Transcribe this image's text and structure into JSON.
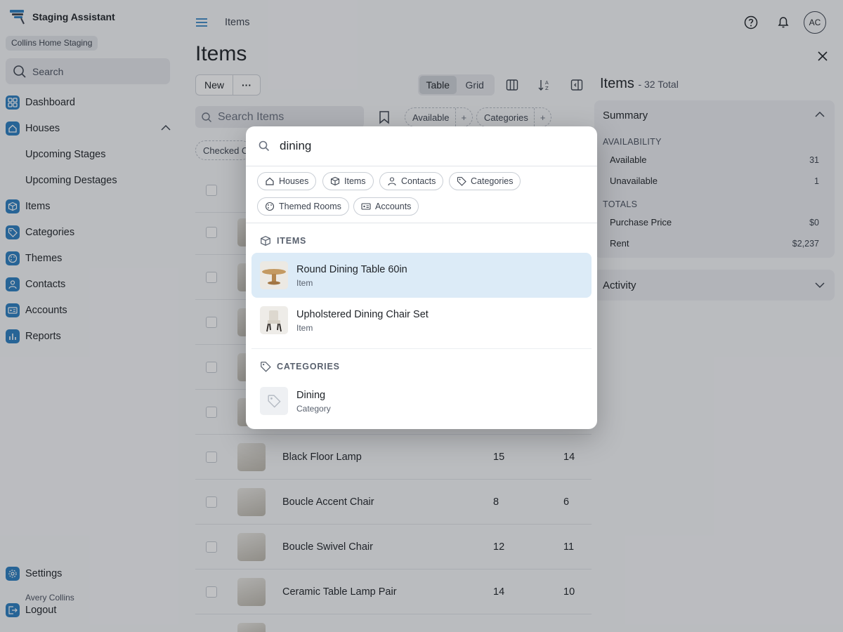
{
  "app": {
    "title": "Staging Assistant",
    "workspace": "Collins Home Staging",
    "search_label": "Search"
  },
  "sidebar": {
    "items": [
      {
        "label": "Dashboard",
        "icon": "grid-icon"
      },
      {
        "label": "Houses",
        "icon": "home-icon",
        "expanded": true
      },
      {
        "label": "Upcoming Stages",
        "sub": true
      },
      {
        "label": "Upcoming Destages",
        "sub": true
      },
      {
        "label": "Items",
        "icon": "box-icon"
      },
      {
        "label": "Categories",
        "icon": "tag-icon"
      },
      {
        "label": "Themes",
        "icon": "palette-icon"
      },
      {
        "label": "Contacts",
        "icon": "person-icon"
      },
      {
        "label": "Accounts",
        "icon": "id-card-icon"
      },
      {
        "label": "Reports",
        "icon": "bar-chart-icon"
      }
    ],
    "settings_label": "Settings",
    "user_name": "Avery Collins",
    "logout_label": "Logout"
  },
  "topbar": {
    "breadcrumb": "Items",
    "avatar_initials": "AC"
  },
  "main": {
    "title": "Items",
    "new_label": "New",
    "more_label": "···",
    "view_toggle": {
      "table": "Table",
      "grid": "Grid",
      "active": "Table"
    },
    "search_placeholder": "Search Items",
    "filters": {
      "available": "Available",
      "categories": "Categories",
      "checked": "Checked C"
    },
    "rows": [
      {
        "name": "Black Floor Lamp",
        "q1": "15",
        "q2": "14"
      },
      {
        "name": "Boucle Accent Chair",
        "q1": "8",
        "q2": "6"
      },
      {
        "name": "Boucle Swivel Chair",
        "q1": "12",
        "q2": "11"
      },
      {
        "name": "Ceramic Table Lamp Pair",
        "q1": "14",
        "q2": "10"
      }
    ]
  },
  "panel": {
    "title": "Items",
    "total": "- 32 Total",
    "summary_label": "Summary",
    "availability_label": "AVAILABILITY",
    "available_label": "Available",
    "available_value": "31",
    "unavailable_label": "Unavailable",
    "unavailable_value": "1",
    "totals_label": "TOTALS",
    "purchase_label": "Purchase Price",
    "purchase_value": "$0",
    "rent_label": "Rent",
    "rent_value": "$2,237",
    "activity_label": "Activity"
  },
  "palette": {
    "query": "dining",
    "filter_chips": [
      "Houses",
      "Items",
      "Contacts",
      "Categories",
      "Themed Rooms",
      "Accounts"
    ],
    "groups": {
      "items_label": "ITEMS",
      "categories_label": "CATEGORIES"
    },
    "results": [
      {
        "title": "Round Dining Table 60in",
        "type": "Item",
        "selected": true
      },
      {
        "title": "Upholstered Dining Chair Set",
        "type": "Item",
        "selected": false
      },
      {
        "title": "Dining",
        "type": "Category",
        "selected": false
      }
    ]
  },
  "colors": {
    "accent": "#2c7fc1",
    "selected_row": "#dcebf7"
  }
}
